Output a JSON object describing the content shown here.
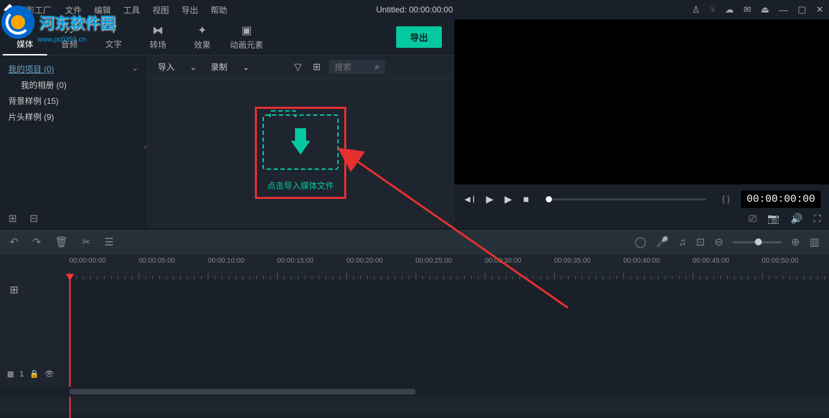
{
  "titlebar": {
    "app_name": "喵影工厂",
    "menus": {
      "file": "文件",
      "edit": "编辑",
      "tools": "工具",
      "view": "视图",
      "export": "导出",
      "help": "帮助"
    },
    "center_title": "Untitled: 00:00:00:00"
  },
  "tabs": {
    "media": "媒体",
    "audio": "音频",
    "text": "文字",
    "transition": "转场",
    "effect": "效果",
    "element": "动画元素",
    "export_btn": "导出"
  },
  "sidebar": {
    "my_project": "我的项目 (0)",
    "my_album": "我的相册 (0)",
    "bg_sample": "背景样例 (15)",
    "title_sample": "片头样例 (9)"
  },
  "media_toolbar": {
    "import": "导入",
    "record": "录制",
    "search_placeholder": "搜索"
  },
  "import_box": {
    "text": "点击导入媒体文件"
  },
  "preview": {
    "braces": "{  }",
    "time": "00:00:00:00"
  },
  "timeline": {
    "ticks": [
      "00:00:00:00",
      "00:00:05:00",
      "00:00:10:00",
      "00:00:15:00",
      "00:00:20:00",
      "00:00:25:00",
      "00:00:30:00",
      "00:00:35:00",
      "00:00:40:00",
      "00:00:45:00",
      "00:00:50:00"
    ],
    "track_label": "1"
  },
  "watermark": {
    "text": "河东软件园",
    "url": "www.pc0359.cn"
  }
}
